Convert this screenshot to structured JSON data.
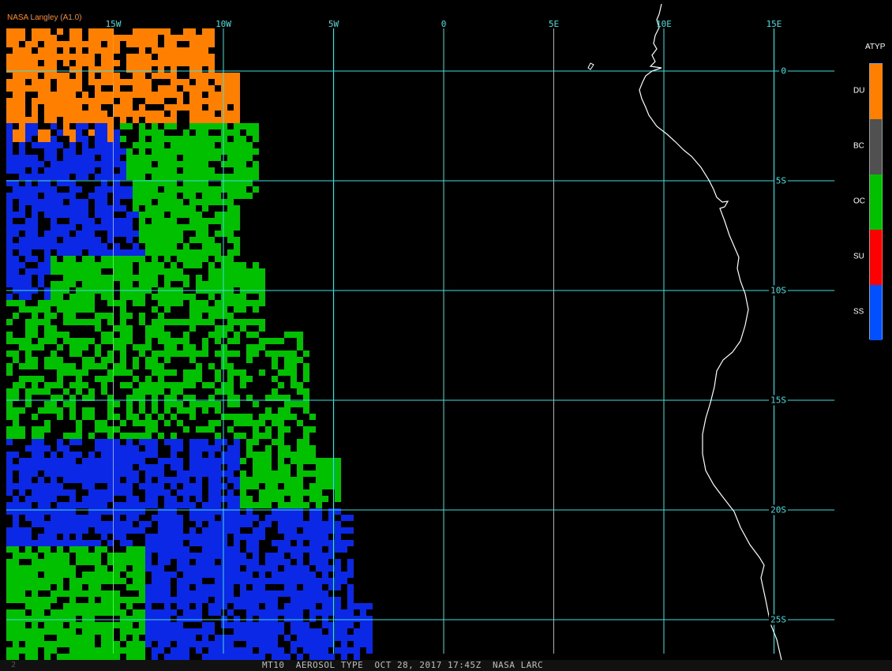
{
  "credit": "NASA Langley (A1.0)",
  "footer": {
    "page_num": "2",
    "caption": "MT10  AEROSOL TYPE  OCT 28, 2017 17:45Z  NASA LARC"
  },
  "grid": {
    "color": "#40e0e0",
    "longitudes": [
      {
        "value": -15,
        "label": "15W"
      },
      {
        "value": -10,
        "label": "10W"
      },
      {
        "value": -5,
        "label": "5W"
      },
      {
        "value": 0,
        "label": "0"
      },
      {
        "value": 5,
        "label": "5E"
      },
      {
        "value": 10,
        "label": "10E"
      },
      {
        "value": 15,
        "label": "15E"
      }
    ],
    "latitudes": [
      {
        "value": 0,
        "label": "0"
      },
      {
        "value": -5,
        "label": "5S"
      },
      {
        "value": -10,
        "label": "10S"
      },
      {
        "value": -15,
        "label": "15S"
      },
      {
        "value": -20,
        "label": "20S"
      },
      {
        "value": -25,
        "label": "25S"
      }
    ]
  },
  "legend": {
    "title": "ATYP",
    "classes": [
      {
        "code": "DU",
        "color": "#ff8000"
      },
      {
        "code": "BC",
        "color": "#505050"
      },
      {
        "code": "OC",
        "color": "#00c000"
      },
      {
        "code": "SU",
        "color": "#ff0000"
      },
      {
        "code": "SS",
        "color": "#0050ff"
      }
    ]
  }
}
